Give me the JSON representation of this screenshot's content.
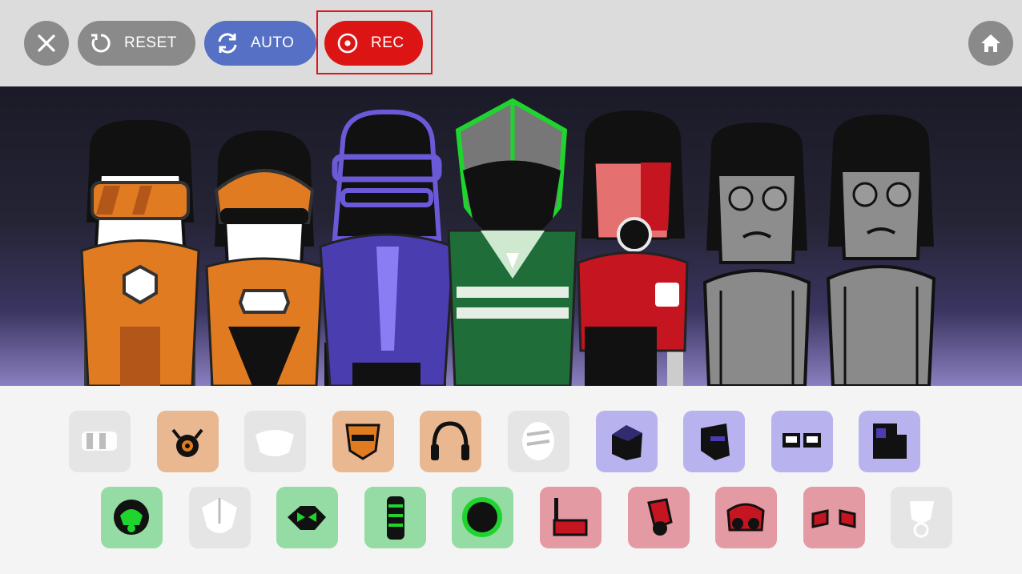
{
  "toolbar": {
    "close_icon": "close-icon",
    "reset_label": "RESET",
    "auto_label": "AUTO",
    "rec_label": "REC",
    "home_icon": "home-icon",
    "colors": {
      "bar": "#dcdcdc",
      "grey_button": "#8a8a8a",
      "auto": "#5570c4",
      "rec": "#dc1414",
      "highlight": "#e0141e"
    }
  },
  "stage": {
    "characters": [
      {
        "slot": 1,
        "type": "orange-visor"
      },
      {
        "slot": 2,
        "type": "orange-helmet"
      },
      {
        "slot": 3,
        "type": "purple-helmet"
      },
      {
        "slot": 4,
        "type": "green-mask"
      },
      {
        "slot": 5,
        "type": "red-cyborg"
      },
      {
        "slot": 6,
        "type": "grey-default"
      },
      {
        "slot": 7,
        "type": "grey-default"
      }
    ]
  },
  "tray": {
    "row1": [
      {
        "name": "sound-icon-1",
        "color": "none"
      },
      {
        "name": "sound-icon-2",
        "color": "orange"
      },
      {
        "name": "sound-icon-3",
        "color": "none"
      },
      {
        "name": "sound-icon-4",
        "color": "orange"
      },
      {
        "name": "sound-icon-5",
        "color": "orange"
      },
      {
        "name": "sound-icon-6",
        "color": "none"
      },
      {
        "name": "sound-icon-7",
        "color": "purple"
      },
      {
        "name": "sound-icon-8",
        "color": "purple"
      },
      {
        "name": "sound-icon-9",
        "color": "purple"
      },
      {
        "name": "sound-icon-10",
        "color": "purple"
      }
    ],
    "row2": [
      {
        "name": "sound-icon-11",
        "color": "green"
      },
      {
        "name": "sound-icon-12",
        "color": "none"
      },
      {
        "name": "sound-icon-13",
        "color": "green"
      },
      {
        "name": "sound-icon-14",
        "color": "green"
      },
      {
        "name": "sound-icon-15",
        "color": "green"
      },
      {
        "name": "sound-icon-16",
        "color": "red"
      },
      {
        "name": "sound-icon-17",
        "color": "red"
      },
      {
        "name": "sound-icon-18",
        "color": "red"
      },
      {
        "name": "sound-icon-19",
        "color": "red"
      },
      {
        "name": "sound-icon-20",
        "color": "none"
      }
    ]
  }
}
